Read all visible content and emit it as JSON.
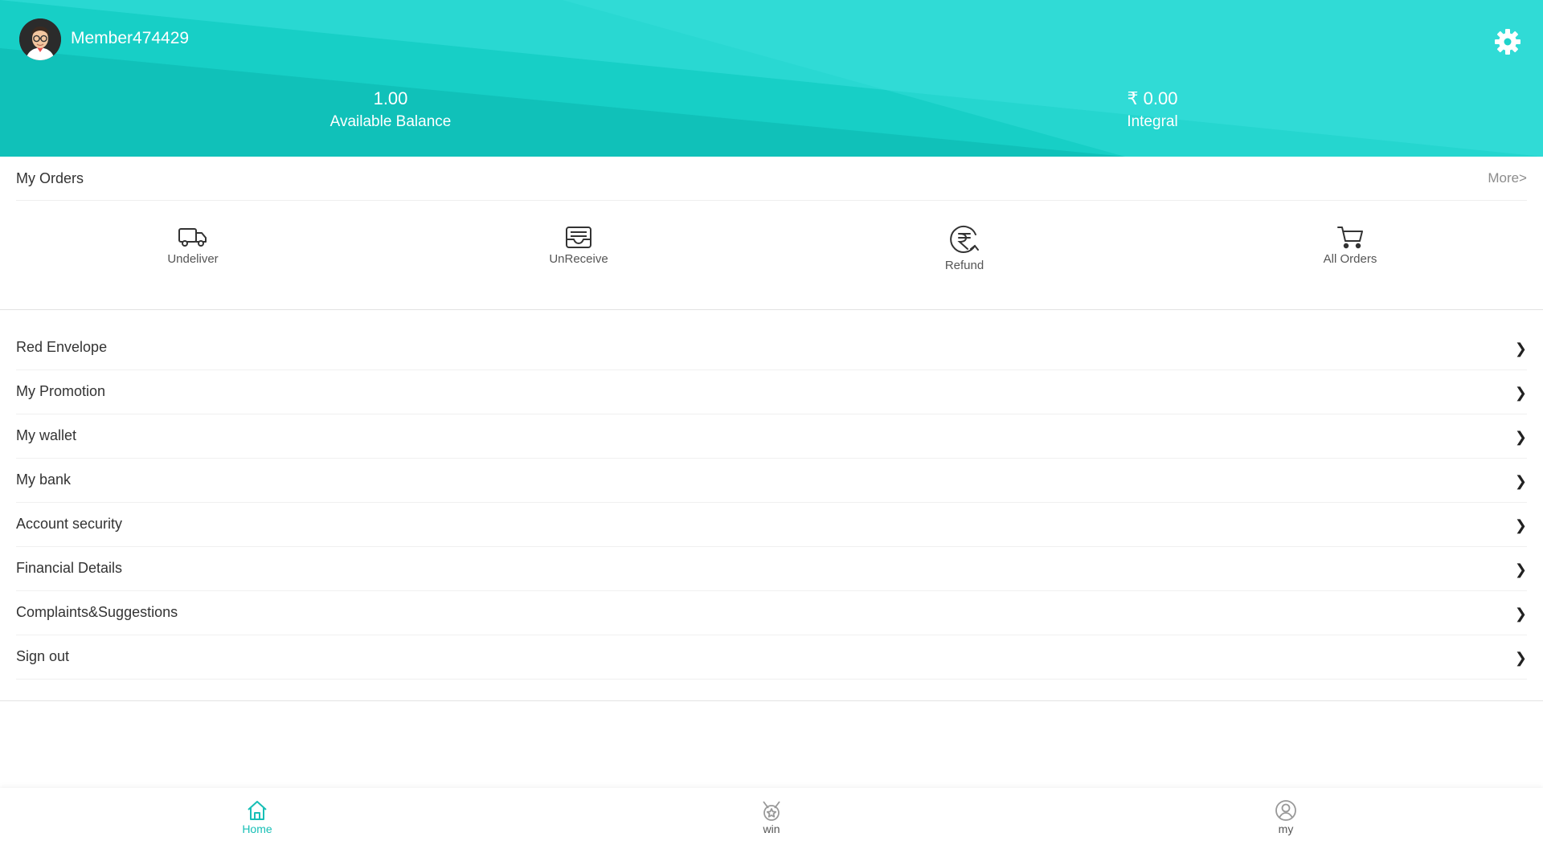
{
  "colors": {
    "accent": "#17cfc6",
    "accent_light": "#38e0dd",
    "accent_dark": "#0bb7ae",
    "tab_active": "#17bfb6",
    "tab_inactive": "#999999"
  },
  "header": {
    "username": "Member474429",
    "balance": {
      "value": "1.00",
      "label": "Available Balance"
    },
    "integral": {
      "value": "₹ 0.00",
      "label": "Integral"
    },
    "settings_icon": "gear-icon"
  },
  "orders": {
    "title": "My Orders",
    "more": "More>",
    "items": [
      {
        "label": "Undeliver",
        "icon": "truck-icon"
      },
      {
        "label": "UnReceive",
        "icon": "inbox-icon"
      },
      {
        "label": "Refund",
        "icon": "rupee-refund-icon"
      },
      {
        "label": "All Orders",
        "icon": "cart-icon"
      }
    ]
  },
  "menu": [
    {
      "label": "Red Envelope",
      "chevron": "❯"
    },
    {
      "label": "My Promotion",
      "chevron": "❯"
    },
    {
      "label": "My wallet",
      "chevron": "❯"
    },
    {
      "label": "My bank",
      "chevron": "❯"
    },
    {
      "label": "Account security",
      "chevron": "❯"
    },
    {
      "label": "Financial Details",
      "chevron": "❯"
    },
    {
      "label": "Complaints&Suggestions",
      "chevron": "❯"
    },
    {
      "label": "Sign out",
      "chevron": "❯"
    }
  ],
  "tabbar": [
    {
      "label": "Home",
      "icon": "home-icon",
      "active": true
    },
    {
      "label": "win",
      "icon": "medal-icon",
      "active": false
    },
    {
      "label": "my",
      "icon": "user-circle-icon",
      "active": false
    }
  ]
}
